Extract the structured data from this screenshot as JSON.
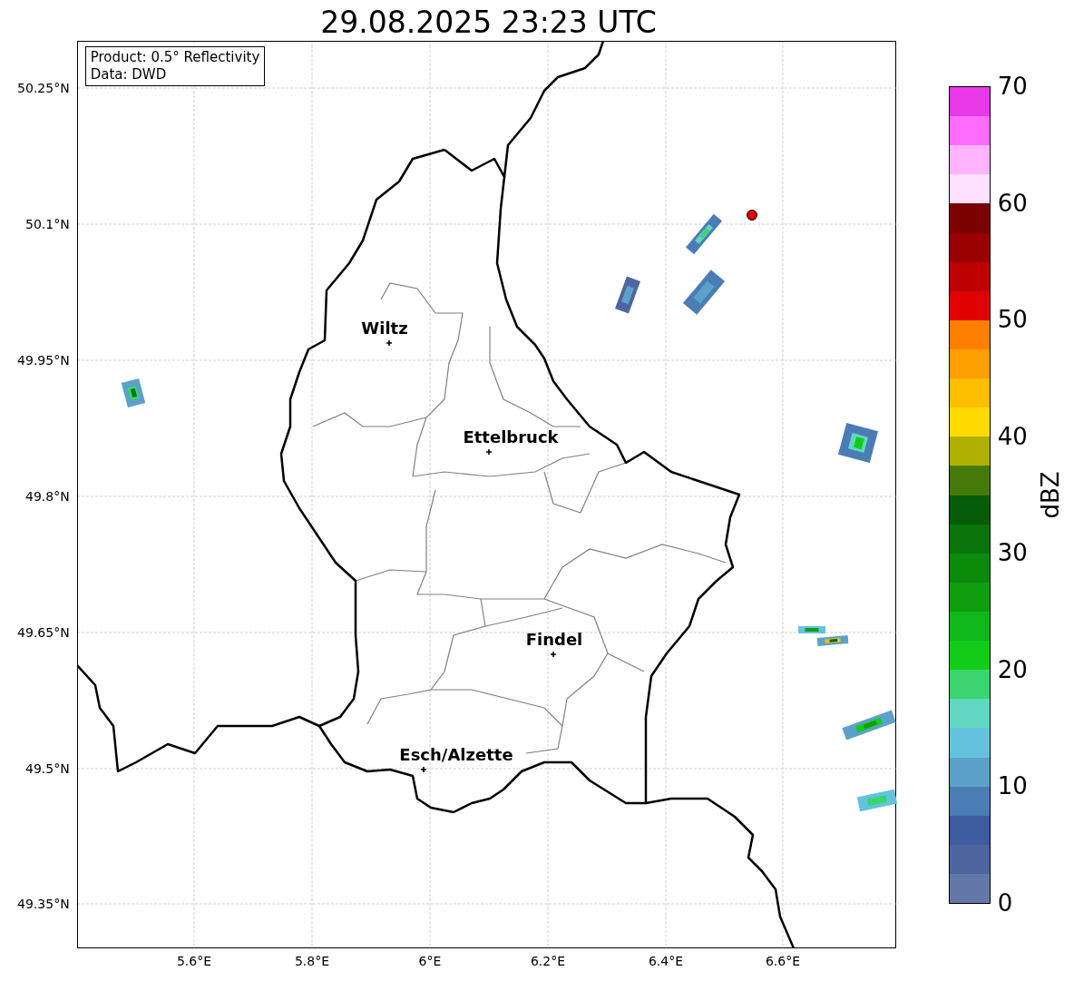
{
  "title": "29.08.2025 23:23 UTC",
  "legend": {
    "lines": [
      "Product: 0.5° Reflectivity",
      "Data: DWD"
    ]
  },
  "map": {
    "lat_ticks": [
      "50.25°N",
      "50.1°N",
      "49.95°N",
      "49.8°N",
      "49.65°N",
      "49.5°N",
      "49.35°N"
    ],
    "lon_ticks": [
      "5.6°E",
      "5.8°E",
      "6°E",
      "6.2°E",
      "6.4°E",
      "6.6°E"
    ],
    "cities": [
      {
        "name": "Wiltz"
      },
      {
        "name": "Ettelbruck"
      },
      {
        "name": "Findel"
      },
      {
        "name": "Esch/Alzette"
      }
    ]
  },
  "colorbar": {
    "label": "dBZ",
    "ticks": [
      "70",
      "60",
      "50",
      "40",
      "30",
      "20",
      "10",
      "0"
    ],
    "bands": [
      {
        "color": "#e839e8"
      },
      {
        "color": "#ff6cff"
      },
      {
        "color": "#ffb3ff"
      },
      {
        "color": "#ffe0ff"
      },
      {
        "color": "#7b0000"
      },
      {
        "color": "#9a0000"
      },
      {
        "color": "#bd0000"
      },
      {
        "color": "#e00000"
      },
      {
        "color": "#ff7f00"
      },
      {
        "color": "#ff9f00"
      },
      {
        "color": "#ffbf00"
      },
      {
        "color": "#ffdb00"
      },
      {
        "color": "#b0b000"
      },
      {
        "color": "#457a0a"
      },
      {
        "color": "#075d07"
      },
      {
        "color": "#0a740a"
      },
      {
        "color": "#0b8a0b"
      },
      {
        "color": "#0e9f0e"
      },
      {
        "color": "#10b71a"
      },
      {
        "color": "#13cc1a"
      },
      {
        "color": "#3bd46e"
      },
      {
        "color": "#61d7c2"
      },
      {
        "color": "#64c2df"
      },
      {
        "color": "#5ca1c9"
      },
      {
        "color": "#4a7db5"
      },
      {
        "color": "#3f5ba0"
      },
      {
        "color": "#4e65a0"
      },
      {
        "color": "#6478a8"
      }
    ]
  }
}
